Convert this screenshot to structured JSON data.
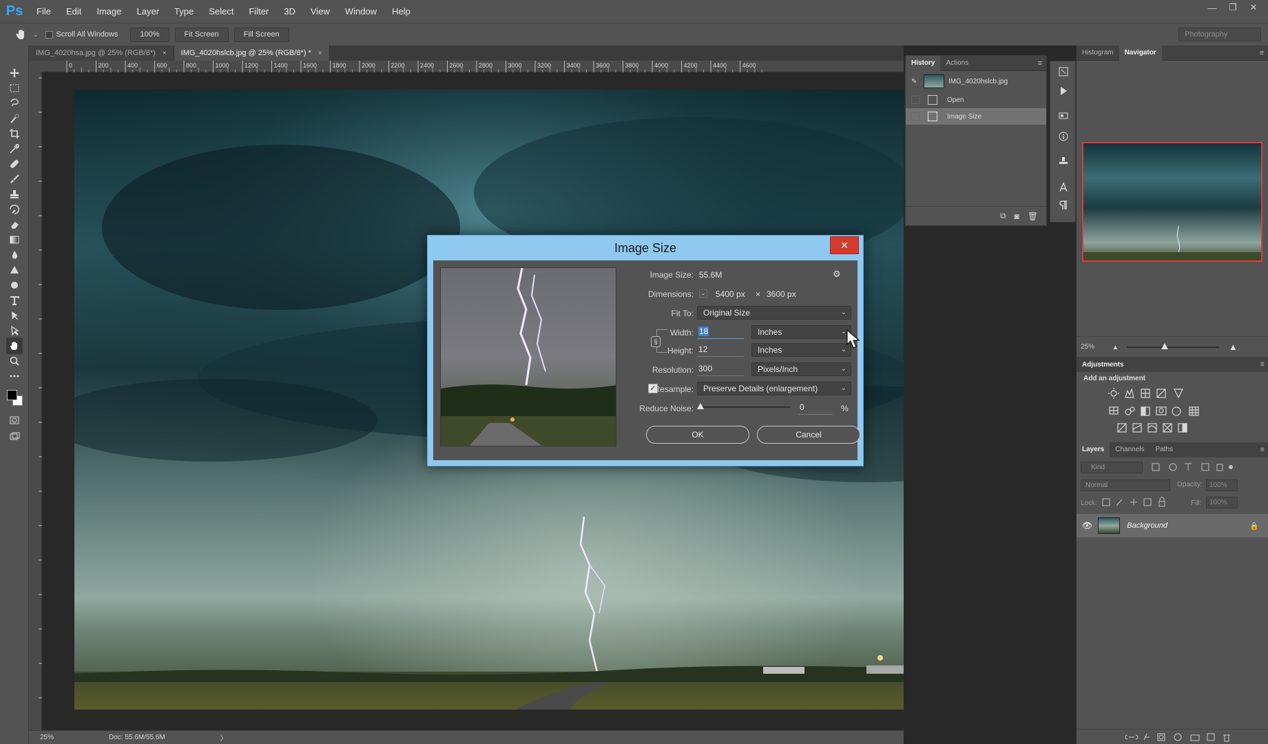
{
  "app": {
    "logo": "Ps",
    "menu": [
      "File",
      "Edit",
      "Image",
      "Layer",
      "Type",
      "Select",
      "Filter",
      "3D",
      "View",
      "Window",
      "Help"
    ],
    "window_controls": [
      "—",
      "❐",
      "✕"
    ]
  },
  "options_bar": {
    "scroll_all_windows": "Scroll All Windows",
    "zoom": "100%",
    "fit_screen": "Fit Screen",
    "fill_screen": "Fill Screen",
    "workspace": "Photography"
  },
  "tabs": [
    {
      "label": "IMG_4020hsa.jpg @ 25% (RGB/8*)",
      "close": "×"
    },
    {
      "label": "IMG_4020hslcb.jpg @ 25% (RGB/8*) *",
      "close": "×"
    }
  ],
  "ruler": {
    "ticks": [
      "0",
      "200",
      "400",
      "600",
      "800",
      "1000",
      "1200",
      "1400",
      "1600",
      "1800",
      "2000",
      "2200",
      "2400",
      "2600",
      "2800",
      "3000",
      "3200",
      "3400",
      "3600",
      "3800",
      "4000",
      "4200",
      "4400",
      "4600"
    ]
  },
  "status_bar": {
    "zoom": "25%",
    "doc": "Doc: 55.6M/55.6M",
    "arrow": "〉"
  },
  "history_panel": {
    "tabs": [
      "History",
      "Actions"
    ],
    "snapshot": "IMG_4020hslcb.jpg",
    "items": [
      "Open",
      "Image Size"
    ]
  },
  "navigator_panel": {
    "tabs": [
      "Histogram",
      "Navigator"
    ],
    "zoom": "25%"
  },
  "adjustments_panel": {
    "title": "Adjustments",
    "subtitle": "Add an adjustment"
  },
  "layers_panel": {
    "tabs": [
      "Layers",
      "Channels",
      "Paths"
    ],
    "filter": "Kind",
    "blend_mode": "Normal",
    "opacity_label": "Opacity:",
    "opacity_value": "100%",
    "lock_label": "Lock:",
    "fill_label": "Fill:",
    "fill_value": "100%",
    "layer_name": "Background"
  },
  "dialog": {
    "title": "Image Size",
    "close": "✕",
    "image_size_label": "Image Size:",
    "image_size_value": "55.6M",
    "dimensions_label": "Dimensions:",
    "dim_width": "5400 px",
    "dim_x": "×",
    "dim_height": "3600 px",
    "fit_to_label": "Fit To:",
    "fit_to_value": "Original Size",
    "width_label": "Width:",
    "width_value": "18",
    "width_unit": "Inches",
    "height_label": "Height:",
    "height_value": "12",
    "height_unit": "Inches",
    "resolution_label": "Resolution:",
    "resolution_value": "300",
    "resolution_unit": "Pixels/Inch",
    "resample_label": "Resample:",
    "resample_value": "Preserve Details (enlargement)",
    "reduce_noise_label": "Reduce Noise:",
    "reduce_noise_value": "0",
    "reduce_noise_unit": "%",
    "reduce_noise_level": 0,
    "ok": "OK",
    "cancel": "Cancel"
  }
}
